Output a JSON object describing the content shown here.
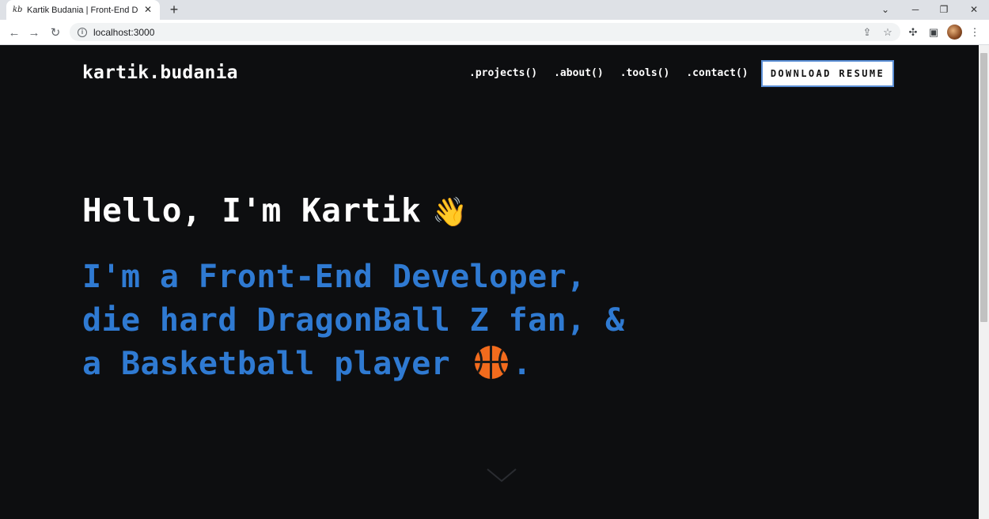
{
  "browser": {
    "tab_favicon": "kb",
    "tab_title": "Kartik Budania | Front-End Developer",
    "url": "localhost:3000"
  },
  "site": {
    "logo": "kartik.budania",
    "nav": [
      ".projects()",
      ".about()",
      ".tools()",
      ".contact()"
    ],
    "resume_button": "DOWNLOAD RESUME"
  },
  "hero": {
    "greeting": "Hello, I'm Kartik",
    "greeting_emoji": "👋",
    "line1": "I'm a Front-End Developer,",
    "line2": "die hard DragonBall Z fan, &",
    "line3_before": "a Basketball player",
    "line3_after": "."
  },
  "colors": {
    "background": "#0d0e10",
    "accent_blue": "#2f7ad2",
    "text_white": "#ffffff"
  },
  "icons": [
    "back-icon",
    "forward-icon",
    "reload-icon",
    "info-icon",
    "share-icon",
    "star-icon",
    "extensions-icon",
    "side-panel-icon",
    "menu-icon",
    "basketball-icon",
    "chevron-down-icon"
  ]
}
